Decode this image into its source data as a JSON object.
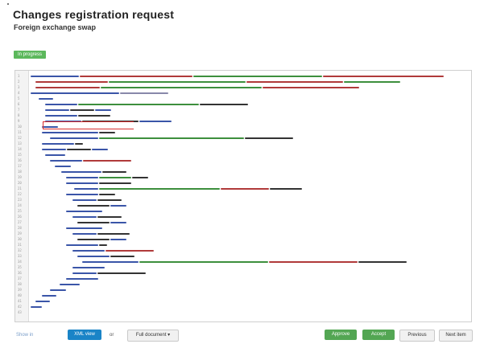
{
  "header": {
    "title": "Changes registration request",
    "subtitle": "Foreign exchange swap"
  },
  "status_badge": "In progress",
  "editor": {
    "line_numbers": [
      "1",
      "2",
      "3",
      "4",
      "5",
      "6",
      "7",
      "8",
      "9",
      "10",
      "11",
      "12",
      "13",
      "14",
      "15",
      "16",
      "17",
      "18",
      "19",
      "20",
      "21",
      "22",
      "23",
      "24",
      "25",
      "26",
      "27",
      "28",
      "29",
      "30",
      "31",
      "32",
      "33",
      "34",
      "35",
      "36",
      "37",
      "38",
      "39",
      "40",
      "41",
      "42",
      "43"
    ]
  },
  "footer": {
    "prefix_label": "Show in",
    "view_mode_label": "XML view",
    "or_label": "or",
    "format_select_label": "Full document ▾",
    "approve_label": "Approve",
    "accept_label": "Accept",
    "previous_label": "Previous",
    "next_label": "Next item"
  },
  "colors": {
    "accent_blue": "#1a84c7",
    "success_green": "#5cb85c",
    "highlight_red": "#d92e2e"
  }
}
